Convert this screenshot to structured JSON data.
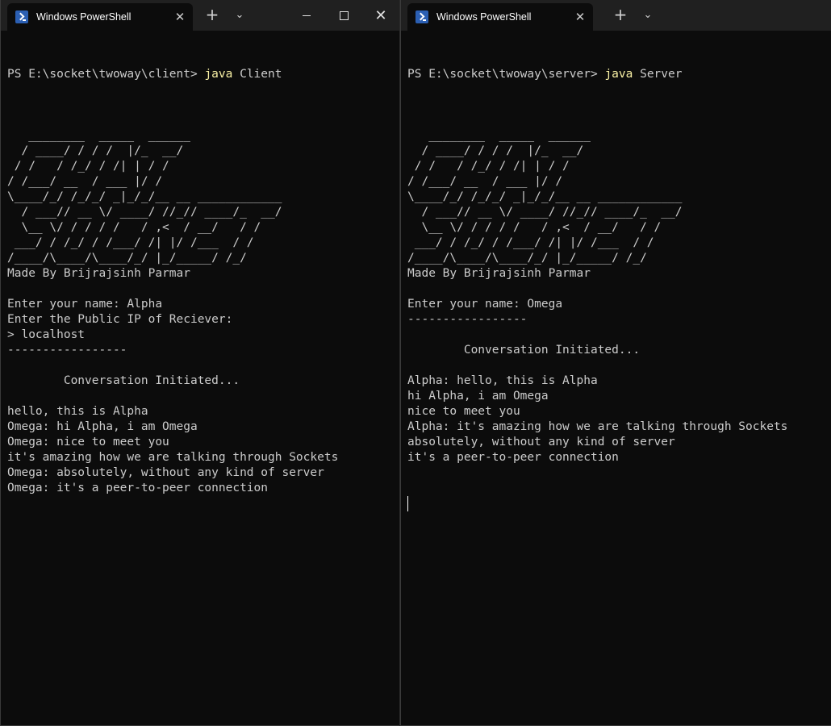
{
  "colors": {
    "background": "#0c0c0c",
    "text": "#cccccc",
    "command": "#f9f1a5",
    "titlebar": "#202020"
  },
  "left": {
    "tab_title": "Windows PowerShell",
    "prompt": "PS E:\\socket\\twoway\\client> ",
    "cmd": "java",
    "cmd_arg": " Client",
    "lines": [
      "",
      "   ________  _____  ______",
      "  / ____/ / / /  |/_  __/",
      " / /   / /_/ / /| | / /",
      "/ /___/ __  / ___ |/ /",
      "\\____/_/ /_/_/ _|_/_/__ __ ____________",
      "  / ___// __ \\/ ____/ //_// ____/_  __/",
      "  \\__ \\/ / / / /   / ,<  / __/   / /",
      " ___/ / /_/ / /___/ /| |/ /___  / /",
      "/____/\\____/\\____/_/ |_/_____/ /_/",
      "Made By Brijrajsinh Parmar",
      "",
      "Enter your name: Alpha",
      "Enter the Public IP of Reciever:",
      "> localhost",
      "-----------------",
      "",
      "        Conversation Initiated...",
      "",
      "hello, this is Alpha",
      "Omega: hi Alpha, i am Omega",
      "Omega: nice to meet you",
      "it's amazing how we are talking through Sockets",
      "Omega: absolutely, without any kind of server",
      "Omega: it's a peer-to-peer connection"
    ]
  },
  "right": {
    "tab_title": "Windows PowerShell",
    "prompt": "PS E:\\socket\\twoway\\server> ",
    "cmd": "java",
    "cmd_arg": " Server",
    "lines": [
      "",
      "   ________  _____  ______",
      "  / ____/ / / /  |/_  __/",
      " / /   / /_/ / /| | / /",
      "/ /___/ __  / ___ |/ /",
      "\\____/_/ /_/_/ _|_/_/__ __ ____________",
      "  / ___// __ \\/ ____/ //_// ____/_  __/",
      "  \\__ \\/ / / / /   / ,<  / __/   / /",
      " ___/ / /_/ / /___/ /| |/ /___  / /",
      "/____/\\____/\\____/_/ |_/_____/ /_/",
      "Made By Brijrajsinh Parmar",
      "",
      "Enter your name: Omega",
      "-----------------",
      "",
      "        Conversation Initiated...",
      "",
      "Alpha: hello, this is Alpha",
      "hi Alpha, i am Omega",
      "nice to meet you",
      "Alpha: it's amazing how we are talking through Sockets",
      "absolutely, without any kind of server",
      "it's a peer-to-peer connection"
    ]
  },
  "icons": {
    "tab_icon": "powershell-icon",
    "tab_close": "close-icon",
    "new_tab": "plus-icon",
    "dropdown": "chevron-down-icon",
    "minimize": "minimize-icon",
    "maximize": "maximize-icon",
    "close": "close-icon"
  },
  "glyphs": {
    "close": "✕",
    "plus": "+",
    "chevron": "⌄"
  }
}
